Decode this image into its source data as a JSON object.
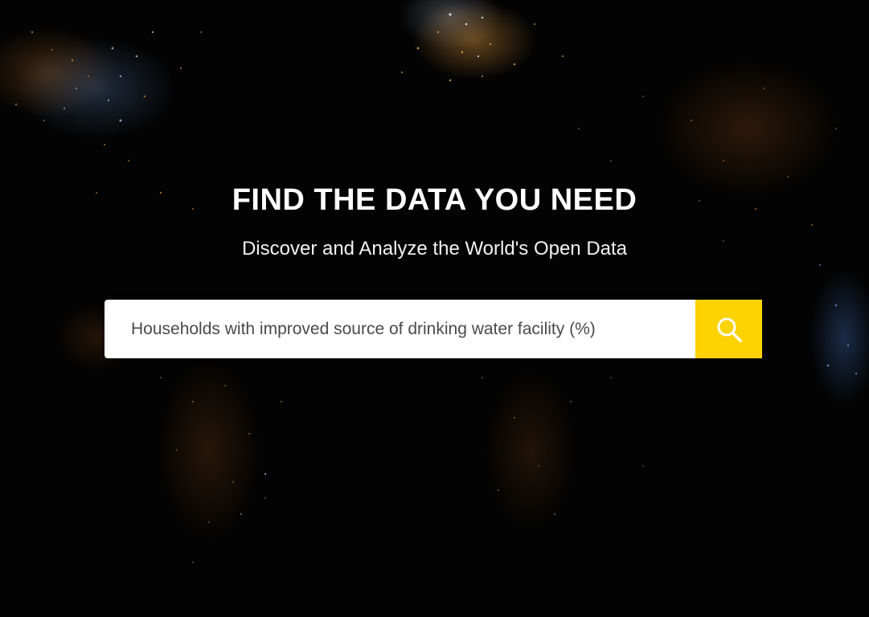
{
  "hero": {
    "title": "FIND THE DATA YOU NEED",
    "subtitle": "Discover and Analyze the World's Open Data"
  },
  "search": {
    "value": "Households with improved source of drinking water facility (%)",
    "button_icon": "search-icon"
  },
  "colors": {
    "background": "#030303",
    "search_button": "#fcd200",
    "title_text": "#ffffff",
    "map_light_orange": "#d9893a",
    "map_light_blue": "#6a93d6"
  },
  "background_image": "world-map-night-lights"
}
